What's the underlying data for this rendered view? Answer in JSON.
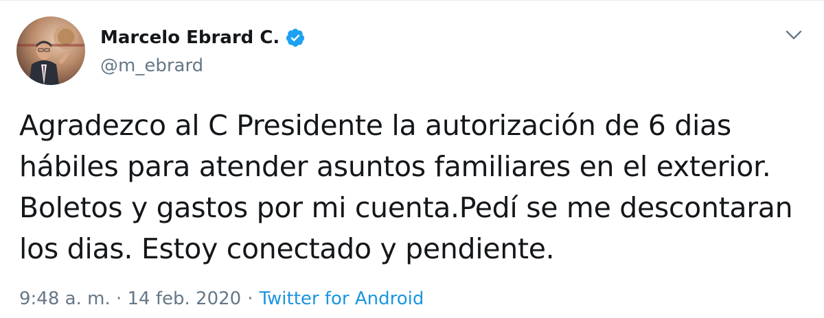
{
  "tweet": {
    "author": {
      "name": "Marcelo Ebrard C.",
      "handle": "@m_ebrard",
      "verified": true
    },
    "text_lines": [
      "Agradezco al C Presidente la autorización de 6 dias",
      "hábiles para atender asuntos familiares en el exterior.",
      "Boletos y gastos por mi cuenta.Pedí se me descontaran",
      "los dias. Estoy conectado y pendiente."
    ],
    "timestamp": "9:48 a. m. · 14 feb. 2020",
    "separator": "·",
    "source": "Twitter for Android"
  },
  "icons": {
    "verified": "verified-badge-icon",
    "menu": "chevron-down-icon"
  },
  "colors": {
    "text": "#14171a",
    "secondary": "#657786",
    "link": "#1b95e0",
    "verified": "#1da1f2"
  }
}
